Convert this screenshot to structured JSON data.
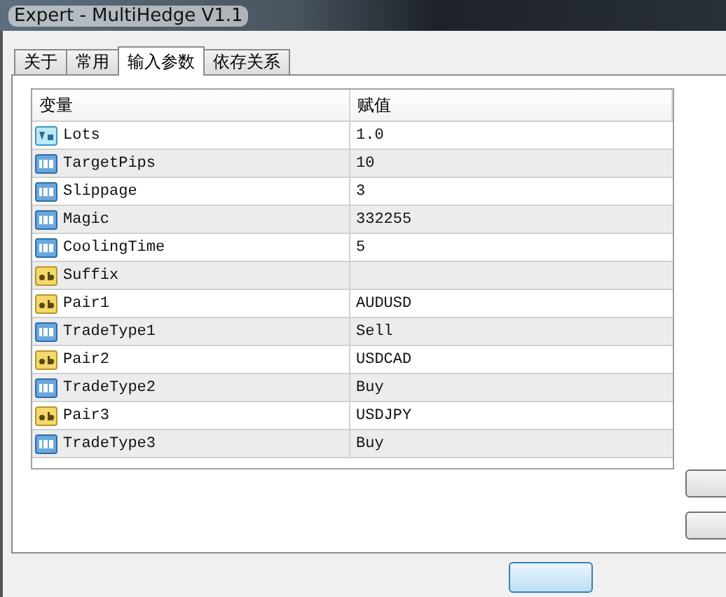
{
  "window": {
    "title": "Expert - MultiHedge V1.1"
  },
  "tabs": [
    {
      "label": "关于",
      "selected": false
    },
    {
      "label": "常用",
      "selected": false
    },
    {
      "label": "输入参数",
      "selected": true
    },
    {
      "label": "依存关系",
      "selected": false
    }
  ],
  "table": {
    "columns": [
      "变量",
      "赋值"
    ],
    "rows": [
      {
        "kind": "double",
        "name": "Lots",
        "value": "1.0"
      },
      {
        "kind": "int",
        "name": "TargetPips",
        "value": "10"
      },
      {
        "kind": "int",
        "name": "Slippage",
        "value": "3"
      },
      {
        "kind": "int",
        "name": "Magic",
        "value": "332255"
      },
      {
        "kind": "int",
        "name": "CoolingTime",
        "value": "5"
      },
      {
        "kind": "string",
        "name": "Suffix"
      },
      {
        "kind": "string",
        "name": "Pair1",
        "value": "AUDUSD"
      },
      {
        "kind": "int",
        "name": "TradeType1",
        "value": "Sell"
      },
      {
        "kind": "string",
        "name": "Pair2",
        "value": "USDCAD"
      },
      {
        "kind": "int",
        "name": "TradeType2",
        "value": "Buy"
      },
      {
        "kind": "string",
        "name": "Pair3",
        "value": "USDJPY"
      },
      {
        "kind": "int",
        "name": "TradeType3",
        "value": "Buy"
      }
    ]
  }
}
